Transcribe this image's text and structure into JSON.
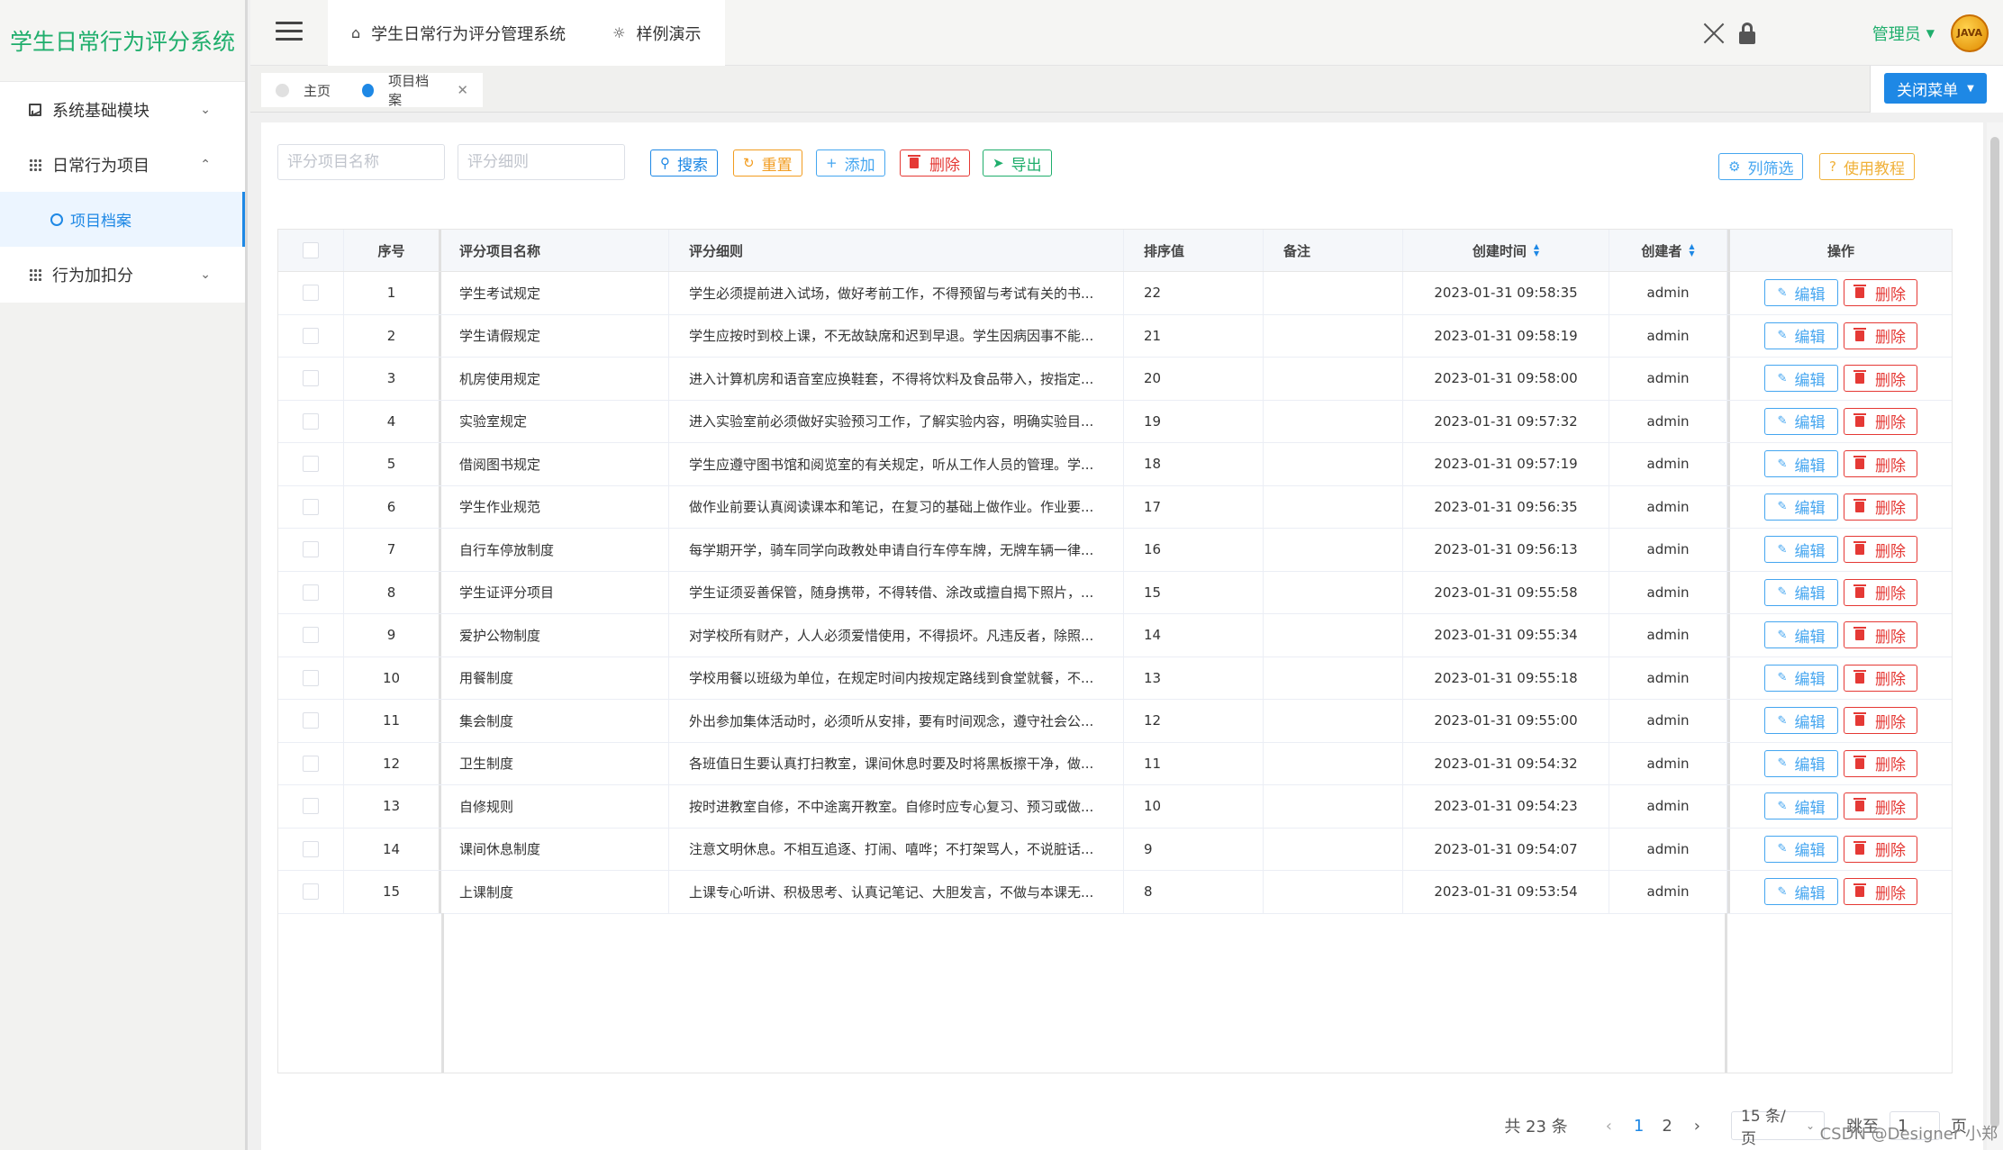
{
  "sidebar": {
    "title": "学生日常行为评分系统",
    "items": [
      {
        "label": "系统基础模块",
        "chevron": "⌄"
      },
      {
        "label": "日常行为项目",
        "chevron": "⌃"
      },
      {
        "label": "行为加扣分",
        "chevron": "⌄"
      }
    ],
    "sub_item": "项目档案"
  },
  "header": {
    "tabs": [
      "学生日常行为评分管理系统",
      "样例演示"
    ],
    "admin": "管理员",
    "avatar_text": "JAVA"
  },
  "tagbar": {
    "home": "主页",
    "current": "项目档案",
    "close_menu": "关闭菜单"
  },
  "search": {
    "name_placeholder": "评分项目名称",
    "detail_placeholder": "评分细则",
    "search": "搜索",
    "reset": "重置",
    "add": "添加",
    "delete": "删除",
    "export": "导出",
    "column_filter": "列筛选",
    "tutorial": "使用教程"
  },
  "table": {
    "headers": [
      "序号",
      "评分项目名称",
      "评分细则",
      "排序值",
      "备注",
      "创建时间",
      "创建者",
      "操作"
    ],
    "edit_label": "编辑",
    "delete_label": "删除",
    "rows": [
      {
        "idx": "1",
        "name": "学生考试规定",
        "detail": "学生必须提前进入试场，做好考前工作，不得预留与考试有关的书...",
        "sort": "22",
        "note": "",
        "time": "2023-01-31 09:58:35",
        "creator": "admin"
      },
      {
        "idx": "2",
        "name": "学生请假规定",
        "detail": "学生应按时到校上课，不无故缺席和迟到早退。学生因病因事不能...",
        "sort": "21",
        "note": "",
        "time": "2023-01-31 09:58:19",
        "creator": "admin"
      },
      {
        "idx": "3",
        "name": "机房使用规定",
        "detail": "进入计算机房和语音室应换鞋套，不得将饮料及食品带入，按指定...",
        "sort": "20",
        "note": "",
        "time": "2023-01-31 09:58:00",
        "creator": "admin"
      },
      {
        "idx": "4",
        "name": "实验室规定",
        "detail": "进入实验室前必须做好实验预习工作，了解实验内容，明确实验目...",
        "sort": "19",
        "note": "",
        "time": "2023-01-31 09:57:32",
        "creator": "admin"
      },
      {
        "idx": "5",
        "name": "借阅图书规定",
        "detail": "学生应遵守图书馆和阅览室的有关规定，听从工作人员的管理。学...",
        "sort": "18",
        "note": "",
        "time": "2023-01-31 09:57:19",
        "creator": "admin"
      },
      {
        "idx": "6",
        "name": "学生作业规范",
        "detail": "做作业前要认真阅读课本和笔记，在复习的基础上做作业。作业要...",
        "sort": "17",
        "note": "",
        "time": "2023-01-31 09:56:35",
        "creator": "admin"
      },
      {
        "idx": "7",
        "name": "自行车停放制度",
        "detail": "每学期开学，骑车同学向政教处申请自行车停车牌，无牌车辆一律...",
        "sort": "16",
        "note": "",
        "time": "2023-01-31 09:56:13",
        "creator": "admin"
      },
      {
        "idx": "8",
        "name": "学生证评分项目",
        "detail": "学生证须妥善保管，随身携带，不得转借、涂改或擅自揭下照片，...",
        "sort": "15",
        "note": "",
        "time": "2023-01-31 09:55:58",
        "creator": "admin"
      },
      {
        "idx": "9",
        "name": "爱护公物制度",
        "detail": "对学校所有财产，人人必须爱惜使用，不得损坏。凡违反者，除照...",
        "sort": "14",
        "note": "",
        "time": "2023-01-31 09:55:34",
        "creator": "admin"
      },
      {
        "idx": "10",
        "name": "用餐制度",
        "detail": "学校用餐以班级为单位，在规定时间内按规定路线到食堂就餐，不...",
        "sort": "13",
        "note": "",
        "time": "2023-01-31 09:55:18",
        "creator": "admin"
      },
      {
        "idx": "11",
        "name": "集会制度",
        "detail": "外出参加集体活动时，必须听从安排，要有时间观念，遵守社会公...",
        "sort": "12",
        "note": "",
        "time": "2023-01-31 09:55:00",
        "creator": "admin"
      },
      {
        "idx": "12",
        "name": "卫生制度",
        "detail": "各班值日生要认真打扫教室，课间休息时要及时将黑板擦干净，做...",
        "sort": "11",
        "note": "",
        "time": "2023-01-31 09:54:32",
        "creator": "admin"
      },
      {
        "idx": "13",
        "name": "自修规则",
        "detail": "按时进教室自修，不中途离开教室。自修时应专心复习、预习或做...",
        "sort": "10",
        "note": "",
        "time": "2023-01-31 09:54:23",
        "creator": "admin"
      },
      {
        "idx": "14",
        "name": "课间休息制度",
        "detail": "注意文明休息。不相互追逐、打闹、嘻哗；不打架骂人，不说脏话...",
        "sort": "9",
        "note": "",
        "time": "2023-01-31 09:54:07",
        "creator": "admin"
      },
      {
        "idx": "15",
        "name": "上课制度",
        "detail": "上课专心听讲、积极思考、认真记笔记、大胆发言，不做与本课无...",
        "sort": "8",
        "note": "",
        "time": "2023-01-31 09:53:54",
        "creator": "admin"
      }
    ]
  },
  "pagination": {
    "total": "共 23 条",
    "pages": [
      "1",
      "2"
    ],
    "page_size": "15 条/页",
    "jump_label": "跳至",
    "jump_value": "1",
    "page_suffix": "页"
  },
  "watermark": "CSDN @Designer 小郑",
  "colors": {
    "brand_green": "#1fae6c",
    "primary_blue": "#1e88e5",
    "danger_red": "#e53935",
    "warning_orange": "#f29c1f"
  }
}
